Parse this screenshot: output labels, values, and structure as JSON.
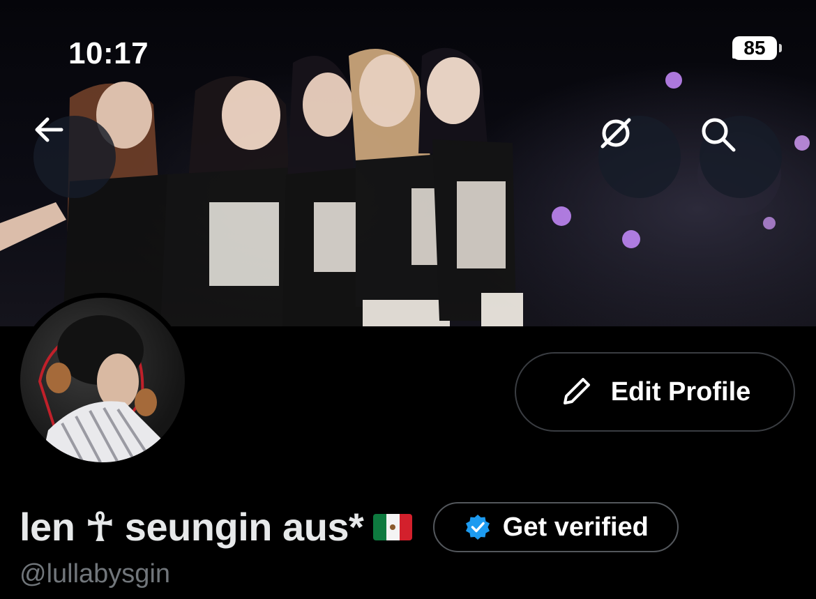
{
  "status_bar": {
    "time": "10:17",
    "battery": "85"
  },
  "banner": {
    "alt": "group performing on stage"
  },
  "nav": {
    "back_icon": "arrow-left-icon",
    "grok_icon": "slash-circle-icon",
    "search_icon": "search-icon"
  },
  "profile": {
    "edit_label": "Edit Profile",
    "name": "len ☥ seungin aus*",
    "flag": "mexico-flag",
    "verify_label": "Get verified",
    "handle": "@lullabysgin"
  },
  "colors": {
    "background": "#000000",
    "text": "#e7e9ea",
    "muted": "#71767b",
    "verified_blue": "#1d9bf0"
  }
}
